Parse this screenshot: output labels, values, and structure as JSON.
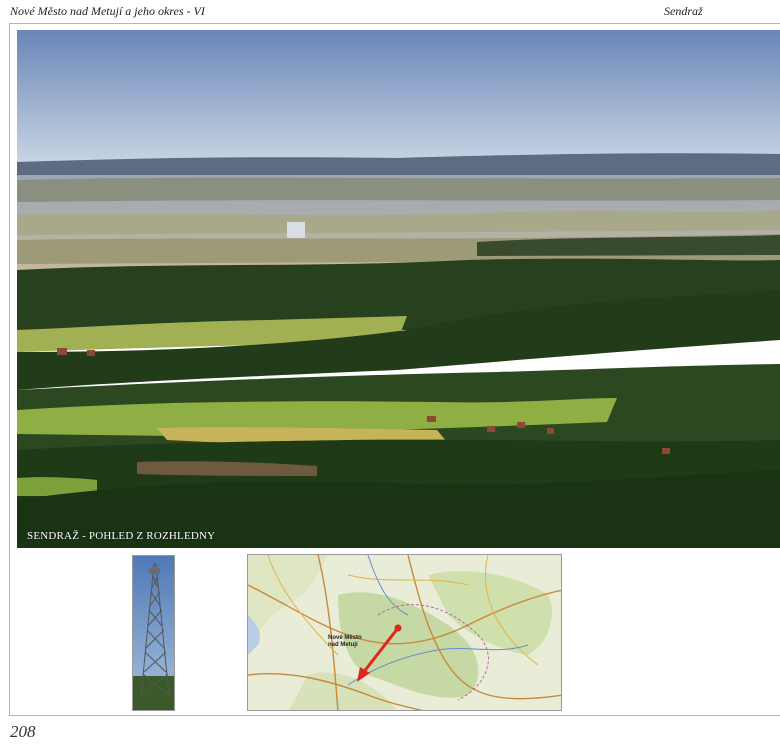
{
  "header": {
    "left_title": "Nové Město nad Metují a jeho okres - VI",
    "right_title": "Sendraž"
  },
  "photo": {
    "caption": "SENDRAŽ - POHLED Z ROZHLEDNY"
  },
  "map": {
    "town_label_line1": "Nové Město",
    "town_label_line2": "nad Metují"
  },
  "page_number": "208",
  "colors": {
    "sky_top": "#6b87b9",
    "sky_bottom": "#c9d5e4",
    "forest_dark": "#1f3a1a",
    "field_green": "#8aa83f",
    "map_arrow": "#e0261b"
  }
}
